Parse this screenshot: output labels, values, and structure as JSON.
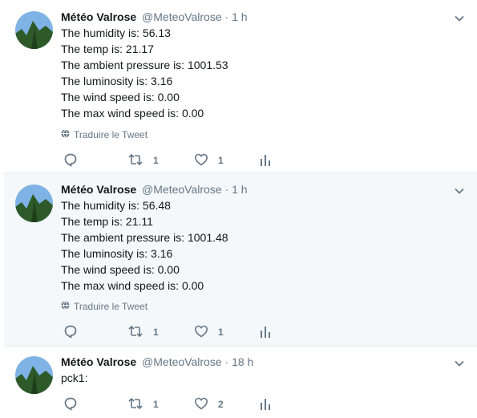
{
  "tweets": [
    {
      "name": "Météo Valrose",
      "handle": "@MeteoValrose",
      "separator": "·",
      "time": "1 h",
      "lines": [
        "The humidity is: 56.13",
        "The temp is: 21.17",
        "The ambient pressure is: 1001.53",
        "The luminosity is: 3.16",
        "The wind speed is: 0.00",
        "The max wind speed is: 0.00"
      ],
      "translate_label": "Traduire le Tweet",
      "retweets": "1",
      "likes": "1"
    },
    {
      "name": "Météo Valrose",
      "handle": "@MeteoValrose",
      "separator": "·",
      "time": "1 h",
      "lines": [
        "The humidity is: 56.48",
        "The temp is: 21.11",
        "The ambient pressure is: 1001.48",
        "The luminosity is: 3.16",
        "The wind speed is: 0.00",
        "The max wind speed is: 0.00"
      ],
      "translate_label": "Traduire le Tweet",
      "retweets": "1",
      "likes": "1"
    },
    {
      "name": "Météo Valrose",
      "handle": "@MeteoValrose",
      "separator": "·",
      "time": "18 h",
      "lines": [
        "pck1:"
      ],
      "retweets": "1",
      "likes": "2"
    }
  ],
  "colors": {
    "text": "#14171a",
    "muted": "#657786",
    "highlight_bg": "#f5f8fa",
    "divider": "#e6ecf0"
  },
  "icons": [
    "chevron-down-icon",
    "reply-icon",
    "retweet-icon",
    "like-icon",
    "analytics-icon",
    "globe-icon"
  ]
}
